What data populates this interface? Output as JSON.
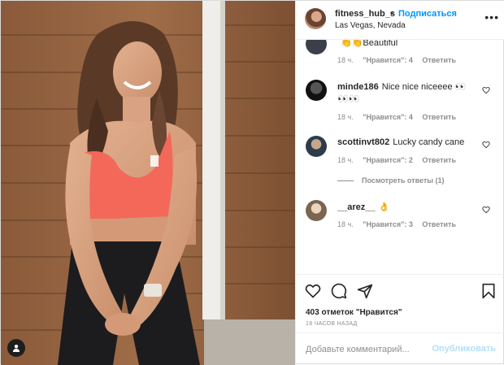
{
  "header": {
    "username": "fitness_hub_s",
    "separator": "•",
    "follow_label": "Подписаться",
    "location": "Las Vegas, Nevada",
    "more_label": "•••"
  },
  "comments": [
    {
      "username": "",
      "text": "👏👏Beautiful",
      "time": "18 ч.",
      "likes": "\"Нравится\": 4",
      "reply": "Ответить"
    },
    {
      "username": "minde186",
      "text": "Nice nice niceeee 👀👀👀",
      "time": "18 ч.",
      "likes": "\"Нравится\": 4",
      "reply": "Ответить"
    },
    {
      "username": "scottinvt802",
      "text": "Lucky candy cane",
      "time": "18 ч.",
      "likes": "\"Нравится\": 2",
      "reply": "Ответить",
      "view_replies": "Посмотреть ответы (1)"
    },
    {
      "username": "__arez__",
      "text": "👌",
      "time": "18 ч.",
      "likes": "\"Нравится\": 3",
      "reply": "Ответить"
    }
  ],
  "load_more_icon": "plus-circle-icon",
  "actions": {
    "icons": [
      "heart-icon",
      "comment-icon",
      "share-icon",
      "bookmark-icon"
    ]
  },
  "likes_text": "403 отметок \"Нравится\"",
  "timestamp": "18 ЧАСОВ НАЗАД",
  "add_comment": {
    "placeholder": "Добавьте комментарий...",
    "publish_label": "Опубликовать"
  },
  "colors": {
    "accent": "#0095f6",
    "publish_disabled": "#b2dffc",
    "muted": "#8e8e8e",
    "text": "#262626"
  }
}
